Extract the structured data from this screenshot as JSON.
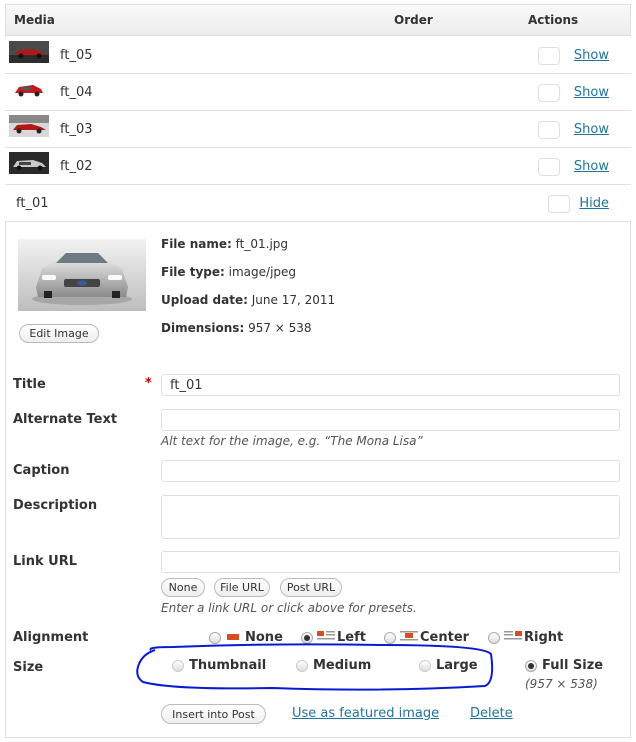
{
  "table": {
    "headers": {
      "media": "Media",
      "order": "Order",
      "actions": "Actions"
    },
    "rows": [
      {
        "title": "ft_05",
        "action": "Show"
      },
      {
        "title": "ft_04",
        "action": "Show"
      },
      {
        "title": "ft_03",
        "action": "Show"
      },
      {
        "title": "ft_02",
        "action": "Show"
      },
      {
        "title": "ft_01",
        "action": "Hide"
      }
    ]
  },
  "details": {
    "file_name_label": "File name:",
    "file_name": "ft_01.jpg",
    "file_type_label": "File type:",
    "file_type": "image/jpeg",
    "upload_date_label": "Upload date:",
    "upload_date": "June 17, 2011",
    "dimensions_label": "Dimensions:",
    "dimensions": "957 × 538",
    "edit_image": "Edit Image"
  },
  "form": {
    "title_label": "Title",
    "required_mark": "*",
    "title_value": "ft_01",
    "alt_label": "Alternate Text",
    "alt_help": "Alt text for the image, e.g. “The Mona Lisa”",
    "caption_label": "Caption",
    "description_label": "Description",
    "link_label": "Link URL",
    "link_buttons": [
      "None",
      "File URL",
      "Post URL"
    ],
    "link_help": "Enter a link URL or click above for presets.",
    "alignment_label": "Alignment",
    "alignment_options": [
      "None",
      "Left",
      "Center",
      "Right"
    ],
    "alignment_selected": "Left",
    "size_label": "Size",
    "size_options": [
      "Thumbnail",
      "Medium",
      "Large",
      "Full Size"
    ],
    "size_selected": "Full Size",
    "full_size_dims": "(957 × 538)",
    "insert_button": "Insert into Post",
    "featured_link": "Use as featured image",
    "delete_link": "Delete"
  },
  "colors": {
    "link": "#21759b",
    "required": "#cc0000",
    "annotation": "#0a1ad0"
  }
}
